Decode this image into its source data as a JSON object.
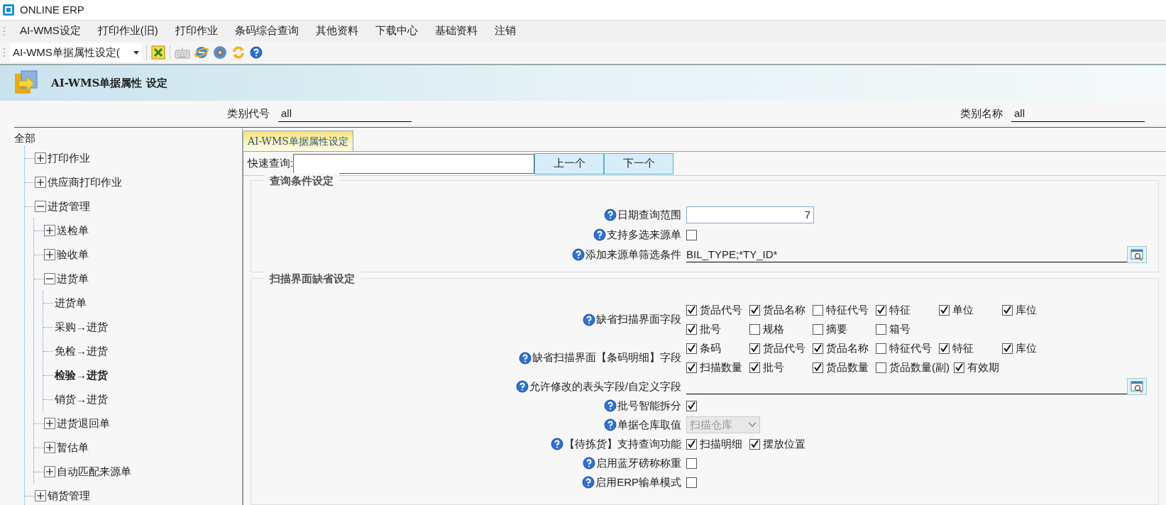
{
  "window": {
    "title": "ONLINE ERP"
  },
  "menu": [
    "AI-WMS设定",
    "打印作业(旧)",
    "打印作业",
    "条码综合查询",
    "其他资料",
    "下载中心",
    "基础资料",
    "注销"
  ],
  "toolbar": {
    "combo": "AI-WMS单据属性设定("
  },
  "header": {
    "title": "AI-WMS单据属性 设定"
  },
  "filters": [
    {
      "label": "类别代号",
      "value": "all"
    },
    {
      "label": "类别名称",
      "value": "all"
    }
  ],
  "tree": {
    "label": "全部",
    "children": [
      {
        "label": "打印作业",
        "expanded": false,
        "selected": false
      },
      {
        "label": "供应商打印作业",
        "expanded": false,
        "selected": false
      },
      {
        "label": "进货管理",
        "expanded": true,
        "selected": false,
        "children": [
          {
            "label": "送检单",
            "expanded": false,
            "selected": false
          },
          {
            "label": "验收单",
            "expanded": false,
            "selected": false
          },
          {
            "label": "进货单",
            "expanded": true,
            "selected": false,
            "children": [
              {
                "label": "进货单",
                "selected": false
              },
              {
                "label": "采购→进货",
                "selected": false
              },
              {
                "label": "免检→进货",
                "selected": false
              },
              {
                "label": "检验→进货",
                "selected": true
              },
              {
                "label": "销货→进货",
                "selected": false
              }
            ]
          },
          {
            "label": "进货退回单",
            "expanded": false,
            "selected": false
          },
          {
            "label": "暂估单",
            "expanded": false,
            "selected": false
          },
          {
            "label": "自动匹配来源单",
            "expanded": false,
            "selected": false
          }
        ]
      },
      {
        "label": "销货管理",
        "expanded": false,
        "selected": false
      }
    ]
  },
  "tabs": [
    {
      "label": "AI-WMS单据属性设定",
      "selected": true
    }
  ],
  "quick_search": {
    "label": "快速查询:",
    "buttons": [
      "上一个",
      "下一个"
    ]
  },
  "sections": [
    {
      "title": "查询条件设定",
      "fields": [
        {
          "kind": "text",
          "label": "日期查询范围",
          "value": "7"
        },
        {
          "kind": "checkbox",
          "label": "支持多选来源单",
          "checked": false
        },
        {
          "kind": "lookup",
          "label": "添加来源单筛选条件",
          "value": "BIL_TYPE;*TY_ID*"
        }
      ]
    },
    {
      "title": "扫描界面缺省设定",
      "fields": [
        {
          "kind": "checkgroup",
          "label": "缺省扫描界面字段",
          "rows": [
            [
              {
                "label": "货品代号",
                "checked": true
              },
              {
                "label": "货品名称",
                "checked": true
              },
              {
                "label": "特征代号",
                "checked": false
              },
              {
                "label": "特征",
                "checked": true
              },
              {
                "label": "单位",
                "checked": true
              },
              {
                "label": "库位",
                "checked": true
              }
            ],
            [
              {
                "label": "批号",
                "checked": true
              },
              {
                "label": "规格",
                "checked": false
              },
              {
                "label": "摘要",
                "checked": false
              },
              {
                "label": "箱号",
                "checked": false
              }
            ]
          ]
        },
        {
          "kind": "checkgroup",
          "label": "缺省扫描界面【条码明细】字段",
          "rows": [
            [
              {
                "label": "条码",
                "checked": true
              },
              {
                "label": "货品代号",
                "checked": true
              },
              {
                "label": "货品名称",
                "checked": true
              },
              {
                "label": "特征代号",
                "checked": false
              },
              {
                "label": "特征",
                "checked": true
              },
              {
                "label": "库位",
                "checked": true
              }
            ],
            [
              {
                "label": "扫描数量",
                "checked": true
              },
              {
                "label": "批号",
                "checked": true
              },
              {
                "label": "货品数量",
                "checked": true
              },
              {
                "label": "货品数量(副)",
                "checked": false
              },
              {
                "label": "有效期",
                "checked": true
              }
            ]
          ]
        },
        {
          "kind": "lookup",
          "label": "允许修改的表头字段/自定义字段"
        },
        {
          "kind": "checkbox",
          "label": "批号智能拆分",
          "checked": true
        },
        {
          "kind": "select",
          "label": "单据仓库取值",
          "value": "扫描仓库",
          "disabled": true
        },
        {
          "kind": "checkgroup",
          "label": "【待拣货】支持查询功能",
          "rows": [
            [
              {
                "label": "扫描明细",
                "checked": true
              },
              {
                "label": "摆放位置",
                "checked": true
              }
            ]
          ]
        },
        {
          "kind": "checkbox",
          "label": "启用蓝牙磅称称重",
          "checked": false
        },
        {
          "kind": "checkbox",
          "label": "启用ERP输单模式",
          "checked": false
        }
      ]
    }
  ]
}
